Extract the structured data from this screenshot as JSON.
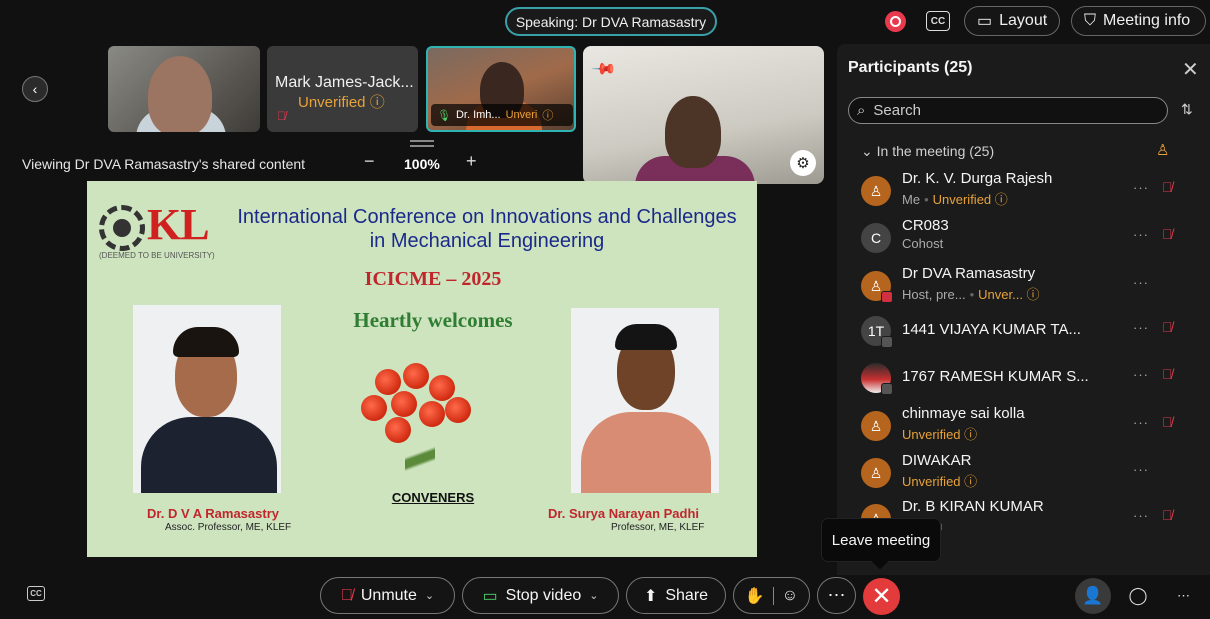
{
  "header": {
    "speaking": "Speaking: Dr DVA Ramasastry",
    "cc_label": "CC",
    "layout_label": "Layout",
    "meeting_info_label": "Meeting info"
  },
  "video_strip": {
    "tile2_name": "Mark James-Jack...",
    "tile2_status": "Unverified",
    "tile3_name": "Dr. Imh...",
    "tile3_status": "Unveri"
  },
  "share_bar": {
    "viewing_text": "Viewing Dr DVA Ramasastry's shared content",
    "zoom_minus": "−",
    "zoom_value": "100%",
    "zoom_plus": "+"
  },
  "slide": {
    "logo_text": "KL",
    "logo_univ": "(DEEMED TO BE UNIVERSITY)",
    "title": "International Conference on Innovations and Challenges in Mechanical Engineering",
    "subtitle": "ICICME – 2025",
    "welcome": "Heartly welcomes",
    "conveners": "CONVENERS",
    "left_name": "Dr. D V A Ramasastry",
    "left_role": "Assoc. Professor, ME, KLEF",
    "right_name": "Dr. Surya Narayan Padhi",
    "right_role": "Professor, ME, KLEF"
  },
  "participants": {
    "title": "Participants (25)",
    "search_placeholder": "Search",
    "section": "In the meeting (25)",
    "list": [
      {
        "initials": "",
        "name": "Dr. K. V. Durga Rajesh",
        "role": "Me",
        "status": "Unverified",
        "muted": true
      },
      {
        "initials": "C",
        "name": "CR083",
        "role": "Cohost",
        "status": "",
        "muted": true
      },
      {
        "initials": "",
        "name": "Dr DVA Ramasastry",
        "role": "Host, pre...",
        "status": "Unver...",
        "muted": false
      },
      {
        "initials": "1T",
        "name": "1441 VIJAYA KUMAR TA...",
        "role": "",
        "status": "",
        "muted": true
      },
      {
        "initials": "",
        "name": "1767 RAMESH KUMAR S...",
        "role": "",
        "status": "",
        "muted": true
      },
      {
        "initials": "",
        "name": "chinmaye sai kolla",
        "role": "",
        "status": "Unverified",
        "muted": true
      },
      {
        "initials": "",
        "name": "DIWAKAR",
        "role": "",
        "status": "Unverified",
        "muted": false
      },
      {
        "initials": "",
        "name": "Dr. B KIRAN KUMAR",
        "role": "",
        "status": "ified",
        "muted": true
      }
    ]
  },
  "tooltip": "Leave meeting",
  "controls": {
    "unmute": "Unmute",
    "stop_video": "Stop video",
    "share": "Share"
  },
  "colors": {
    "accent_teal": "#3aa0a8",
    "unverified": "#e8a23a",
    "danger": "#e33b3b",
    "slide_bg": "#cde4bf"
  }
}
